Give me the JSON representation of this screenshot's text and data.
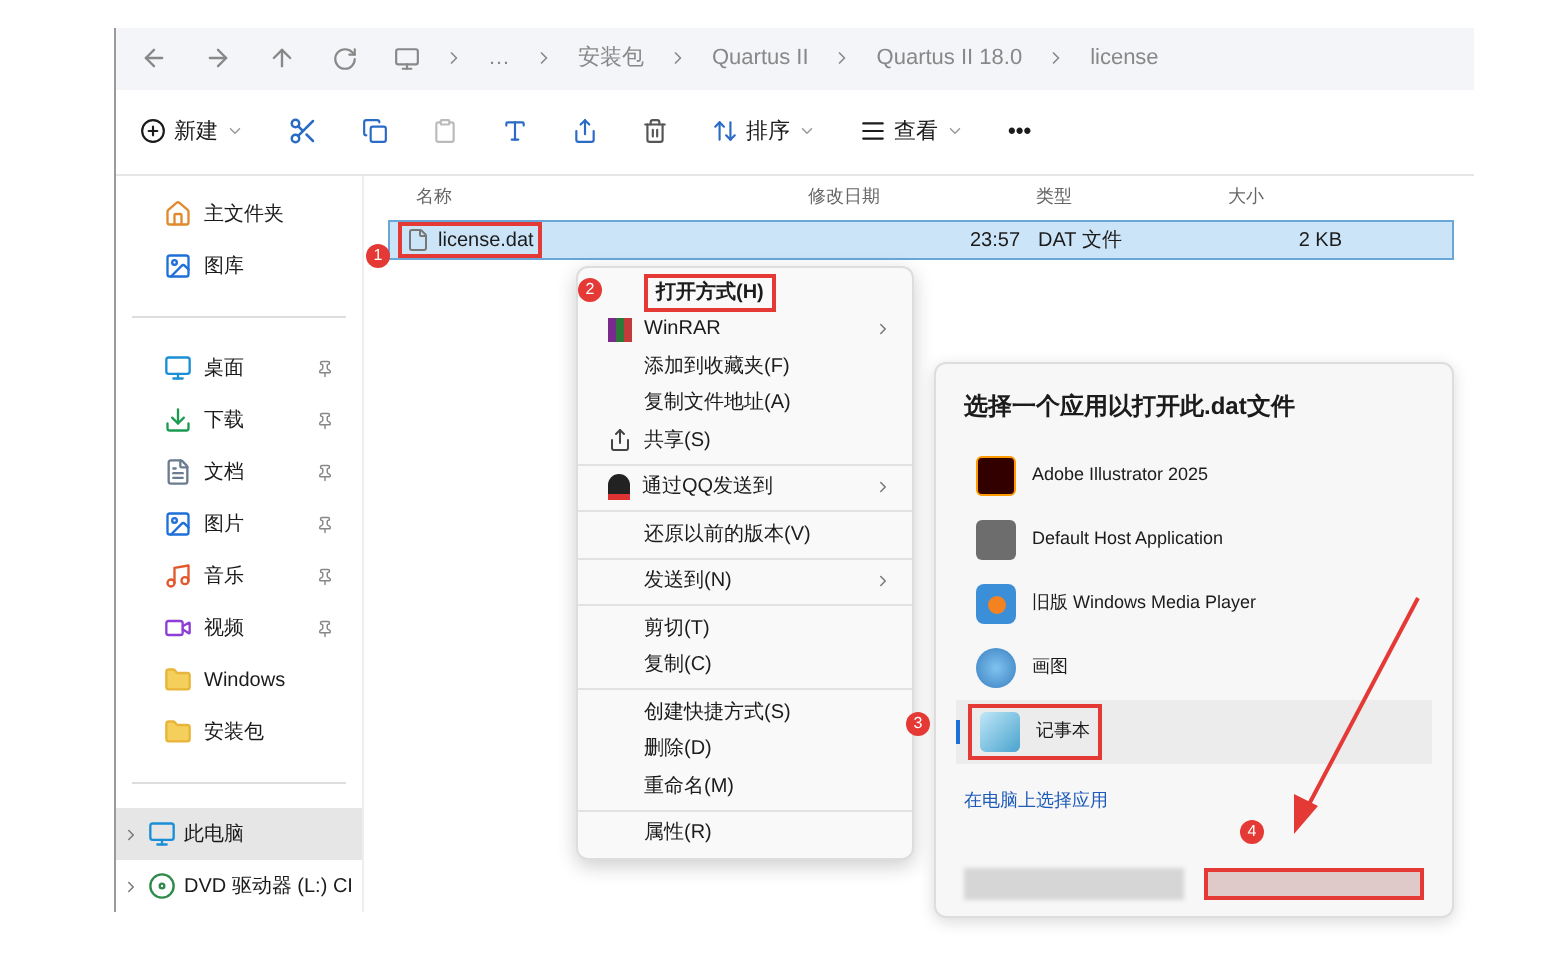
{
  "address_bar": {
    "crumbs": [
      "…",
      "安装包",
      "Quartus II",
      "Quartus II 18.0",
      "license"
    ]
  },
  "toolbar": {
    "new": "新建",
    "sort": "排序",
    "view": "查看",
    "more": "•••"
  },
  "sidebar": {
    "groups": [
      [
        {
          "label": "主文件夹",
          "kind": "home",
          "selected": false
        },
        {
          "label": "图库",
          "kind": "gallery",
          "selected": false
        }
      ],
      [
        {
          "label": "桌面",
          "kind": "desktop",
          "pinned": true,
          "selected": false
        },
        {
          "label": "下载",
          "kind": "download",
          "pinned": true,
          "selected": false
        },
        {
          "label": "文档",
          "kind": "document",
          "pinned": true,
          "selected": false
        },
        {
          "label": "图片",
          "kind": "picture",
          "pinned": true,
          "selected": false
        },
        {
          "label": "音乐",
          "kind": "music",
          "pinned": true,
          "selected": false
        },
        {
          "label": "视频",
          "kind": "video",
          "pinned": true,
          "selected": false
        },
        {
          "label": "Windows",
          "kind": "folder",
          "pinned": false,
          "selected": false
        },
        {
          "label": "安装包",
          "kind": "folder",
          "pinned": false,
          "selected": false
        }
      ],
      [
        {
          "label": "此电脑",
          "kind": "pc",
          "expandable": true,
          "selected": true
        },
        {
          "label": "DVD 驱动器 (L:) CI",
          "kind": "dvd",
          "expandable": true,
          "selected": false
        }
      ]
    ]
  },
  "table": {
    "columns": [
      "名称",
      "修改日期",
      "类型",
      "大小"
    ],
    "rows": [
      {
        "name": "license.dat",
        "modified": "23:57",
        "type": "DAT 文件",
        "size": "2 KB",
        "selected": true
      }
    ]
  },
  "context_menu": {
    "items": [
      {
        "kind": "item",
        "label": "打开方式(H)",
        "submenu": false,
        "highlighted": true
      },
      {
        "kind": "archive",
        "label": "WinRAR",
        "submenu": true,
        "highlighted": false
      },
      {
        "kind": "item",
        "label": "添加到收藏夹(F)",
        "submenu": false,
        "highlighted": false
      },
      {
        "kind": "item",
        "label": "复制文件地址(A)",
        "submenu": false,
        "highlighted": false
      },
      {
        "kind": "share",
        "label": "共享(S)",
        "submenu": false,
        "highlighted": false
      },
      {
        "kind": "separator"
      },
      {
        "kind": "qq",
        "label": "通过QQ发送到",
        "submenu": true,
        "highlighted": false
      },
      {
        "kind": "separator"
      },
      {
        "kind": "item",
        "label": "还原以前的版本(V)",
        "submenu": false,
        "highlighted": false
      },
      {
        "kind": "separator"
      },
      {
        "kind": "item",
        "label": "发送到(N)",
        "submenu": true,
        "highlighted": false
      },
      {
        "kind": "separator"
      },
      {
        "kind": "item",
        "label": "剪切(T)",
        "submenu": false,
        "highlighted": false
      },
      {
        "kind": "item",
        "label": "复制(C)",
        "submenu": false,
        "highlighted": false
      },
      {
        "kind": "separator"
      },
      {
        "kind": "item",
        "label": "创建快捷方式(S)",
        "submenu": false,
        "highlighted": false
      },
      {
        "kind": "item",
        "label": "删除(D)",
        "submenu": false,
        "highlighted": false
      },
      {
        "kind": "item",
        "label": "重命名(M)",
        "submenu": false,
        "highlighted": false
      },
      {
        "kind": "separator"
      },
      {
        "kind": "item",
        "label": "属性(R)",
        "submenu": false,
        "highlighted": false
      }
    ]
  },
  "open_with_dialog": {
    "title": "选择一个应用以打开此.dat文件",
    "apps": [
      {
        "name": "Adobe Illustrator 2025",
        "kind": "illustrator",
        "selected": false
      },
      {
        "name": "Default Host Application",
        "kind": "vm",
        "selected": false
      },
      {
        "name": "旧版 Windows Media Player",
        "kind": "media",
        "selected": false
      },
      {
        "name": "画图",
        "kind": "paint",
        "selected": false
      },
      {
        "name": "记事本",
        "kind": "notepad",
        "selected": true
      }
    ],
    "link": "在电脑上选择应用"
  },
  "annotations": [
    "1",
    "2",
    "3",
    "4"
  ]
}
